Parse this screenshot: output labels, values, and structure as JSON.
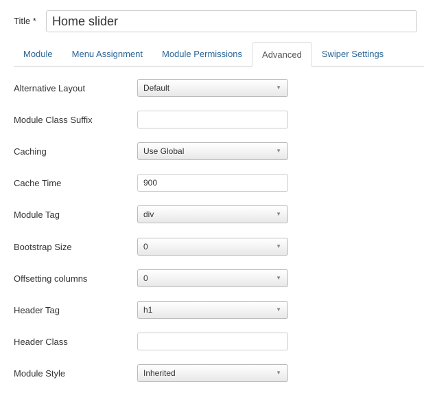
{
  "title": {
    "label": "Title *",
    "value": "Home slider"
  },
  "tabs": [
    {
      "label": "Module"
    },
    {
      "label": "Menu Assignment"
    },
    {
      "label": "Module Permissions"
    },
    {
      "label": "Advanced",
      "active": true
    },
    {
      "label": "Swiper Settings"
    }
  ],
  "fields": [
    {
      "label": "Alternative Layout",
      "type": "select",
      "value": "Default"
    },
    {
      "label": "Module Class Suffix",
      "type": "text",
      "value": ""
    },
    {
      "label": "Caching",
      "type": "select",
      "value": "Use Global"
    },
    {
      "label": "Cache Time",
      "type": "text",
      "value": "900"
    },
    {
      "label": "Module Tag",
      "type": "select",
      "value": "div"
    },
    {
      "label": "Bootstrap Size",
      "type": "select",
      "value": "0"
    },
    {
      "label": "Offsetting columns",
      "type": "select",
      "value": "0"
    },
    {
      "label": "Header Tag",
      "type": "select",
      "value": "h1"
    },
    {
      "label": "Header Class",
      "type": "text",
      "value": ""
    },
    {
      "label": "Module Style",
      "type": "select",
      "value": "Inherited"
    }
  ]
}
